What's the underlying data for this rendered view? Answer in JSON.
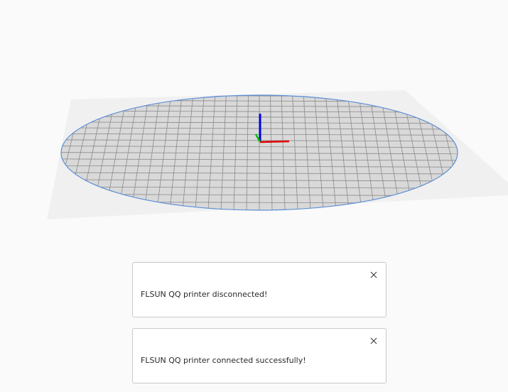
{
  "viewport": {
    "background_color": "#fafafa",
    "ground_plane_color": "#f0f0f0",
    "build_plate_fill": "#d9d9d9",
    "build_plate_grid_color": "#8a8a8a",
    "build_plate_outline": "#5b8fd6",
    "axis_x_color": "#e00000",
    "axis_y_color": "#00c000",
    "axis_z_color": "#0000e0"
  },
  "notifications": [
    {
      "message": "FLSUN QQ printer disconnected!",
      "close_icon": "close-icon"
    },
    {
      "message": "FLSUN QQ printer connected successfully!",
      "close_icon": "close-icon"
    }
  ]
}
